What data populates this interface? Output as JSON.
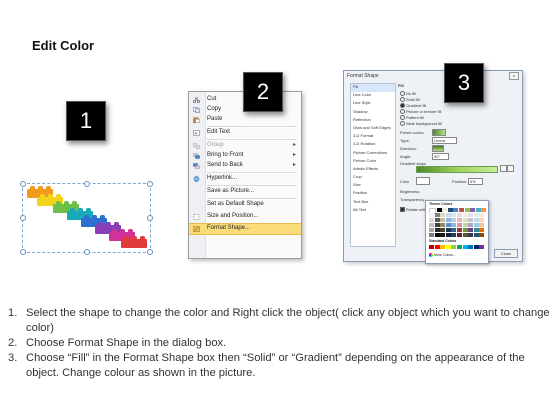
{
  "page": {
    "title": "Edit Color"
  },
  "steps": [
    "1",
    "2",
    "3"
  ],
  "context_menu": {
    "items": [
      {
        "label": "Cut",
        "icon": "scissors-icon"
      },
      {
        "label": "Copy",
        "icon": "copy-icon"
      },
      {
        "label": "Paste",
        "icon": "paste-icon"
      },
      {
        "label": "Edit Text",
        "icon": "edit-text-icon"
      },
      {
        "label": "Group",
        "icon": "group-icon",
        "disabled": true,
        "submenu": true
      },
      {
        "label": "Bring to Front",
        "icon": "bring-front-icon",
        "submenu": true
      },
      {
        "label": "Send to Back",
        "icon": "send-back-icon",
        "submenu": true
      },
      {
        "label": "Hyperlink...",
        "icon": "hyperlink-icon"
      },
      {
        "label": "Save as Picture...",
        "icon": ""
      },
      {
        "label": "Set as Default Shape",
        "icon": ""
      },
      {
        "label": "Size and Position...",
        "icon": "size-position-icon"
      },
      {
        "label": "Format Shape...",
        "icon": "format-shape-icon",
        "highlighted": true
      }
    ]
  },
  "format_dialog": {
    "title": "Format Shape",
    "close": "x",
    "categories": [
      "Fill",
      "Line Color",
      "Line Style",
      "Shadow",
      "Reflection",
      "Glow and Soft Edges",
      "3-D Format",
      "3-D Rotation",
      "Picture Corrections",
      "Picture Color",
      "Artistic Effects",
      "Crop",
      "Size",
      "Position",
      "Text Box",
      "Alt Text"
    ],
    "fill_heading": "Fill",
    "fill_options": [
      {
        "label": "No fill",
        "selected": false
      },
      {
        "label": "Solid fill",
        "selected": false
      },
      {
        "label": "Gradient fill",
        "selected": true
      },
      {
        "label": "Picture or texture fill",
        "selected": false
      },
      {
        "label": "Pattern fill",
        "selected": false
      },
      {
        "label": "Slide background fill",
        "selected": false
      }
    ],
    "fields": [
      {
        "label": "Preset colors:",
        "value": ""
      },
      {
        "label": "Type:",
        "value": "Linear"
      },
      {
        "label": "Direction:",
        "value": ""
      },
      {
        "label": "Angle:",
        "value": "90°"
      }
    ],
    "gradient_stops_label": "Gradient stops",
    "color_label": "Color",
    "position_label": "Position:",
    "position_value": "6%",
    "brightness_label": "Brightness:",
    "transparency_label": "Transparency:",
    "rotate_label": "Rotate with shape",
    "close_button": "Close",
    "theme_colors_label": "Theme Colors",
    "standard_colors_label": "Standard Colors",
    "more_colors_label": "More Colors..."
  },
  "instructions": [
    {
      "num": "1.",
      "text": "Select the shape to change the color and Right click the object( click any object which you want to change color)"
    },
    {
      "num": "2.",
      "text": "Choose Format Shape in the dialog box."
    },
    {
      "num": "3.",
      "text": "Choose “Fill” in the Format Shape box then “Solid” or “Gradient” depending on the appearance of the object. Change colour as shown in the picture."
    }
  ],
  "colors": {
    "brick_orange": "#f39a1e",
    "brick_yellow": "#f2d21a",
    "brick_green": "#6cc04a",
    "brick_teal": "#1aa9b8",
    "brick_blue": "#2b6fd1",
    "brick_purple": "#8a3fb8",
    "brick_magenta": "#d0329a",
    "brick_red": "#e03a3a",
    "menu_highlight": "#fbdc7a"
  }
}
